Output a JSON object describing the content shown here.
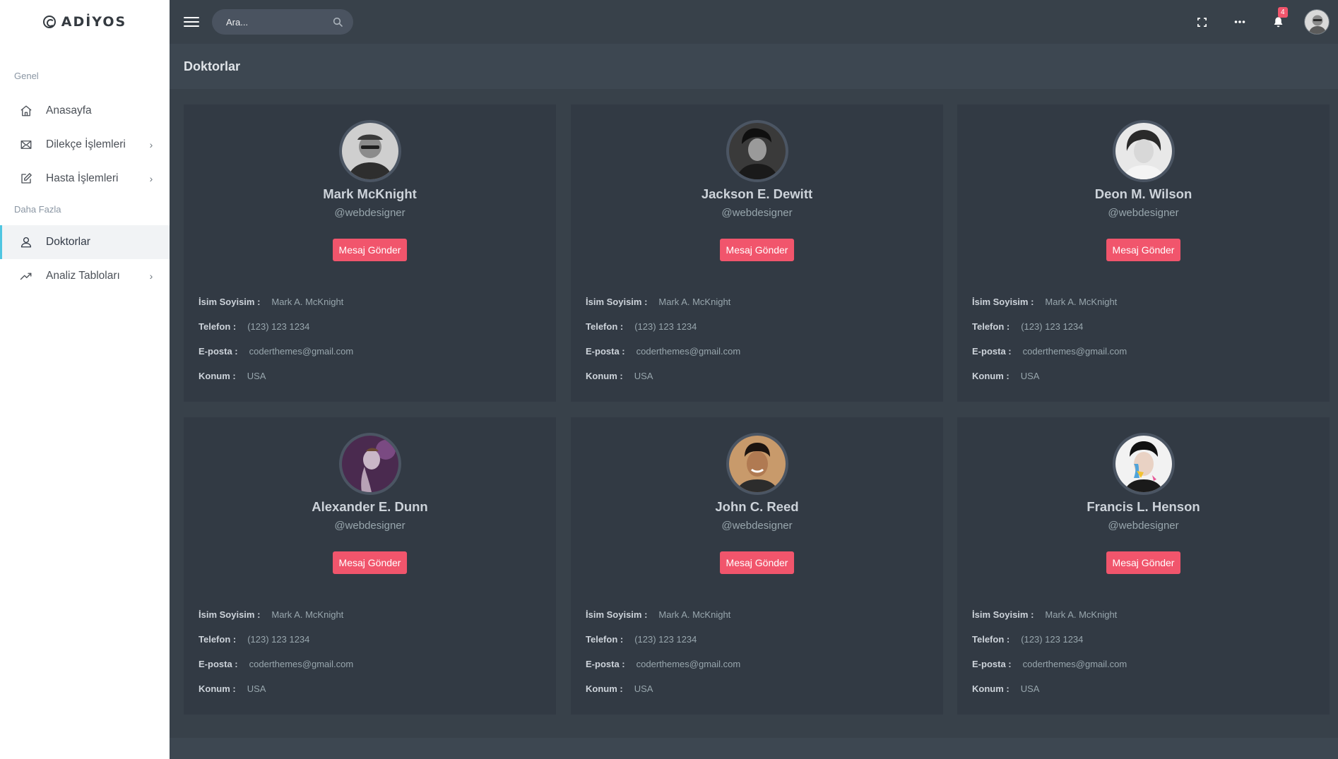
{
  "brand": {
    "name": "ADİYOS"
  },
  "sidebar": {
    "section_general": "Genel",
    "section_more": "Daha Fazla",
    "items": [
      {
        "label": "Anasayfa",
        "icon": "home-icon",
        "has_submenu": false
      },
      {
        "label": "Dilekçe İşlemleri",
        "icon": "envelope-icon",
        "has_submenu": true
      },
      {
        "label": "Hasta İşlemleri",
        "icon": "edit-icon",
        "has_submenu": true
      }
    ],
    "more_items": [
      {
        "label": "Doktorlar",
        "icon": "user-icon",
        "active": true,
        "has_submenu": false
      },
      {
        "label": "Analiz Tabloları",
        "icon": "trending-up-icon",
        "has_submenu": true
      }
    ]
  },
  "topbar": {
    "search_placeholder": "Ara...",
    "notification_count": "4",
    "icons": [
      "menu-icon",
      "search-icon",
      "fullscreen-icon",
      "more-icon",
      "bell-icon"
    ]
  },
  "page": {
    "title": "Doktorlar"
  },
  "labels": {
    "name": "İsim Soyisim :",
    "phone": "Telefon :",
    "email": "E-posta :",
    "location": "Konum :",
    "message_button": "Mesaj Gönder"
  },
  "doctors": [
    {
      "name": "Mark McKnight",
      "handle": "@webdesigner",
      "full_name": "Mark A. McKnight",
      "phone": "(123) 123 1234",
      "email": "coderthemes@gmail.com",
      "location": "USA"
    },
    {
      "name": "Jackson E. Dewitt",
      "handle": "@webdesigner",
      "full_name": "Mark A. McKnight",
      "phone": "(123) 123 1234",
      "email": "coderthemes@gmail.com",
      "location": "USA"
    },
    {
      "name": "Deon M. Wilson",
      "handle": "@webdesigner",
      "full_name": "Mark A. McKnight",
      "phone": "(123) 123 1234",
      "email": "coderthemes@gmail.com",
      "location": "USA"
    },
    {
      "name": "Alexander E. Dunn",
      "handle": "@webdesigner",
      "full_name": "Mark A. McKnight",
      "phone": "(123) 123 1234",
      "email": "coderthemes@gmail.com",
      "location": "USA"
    },
    {
      "name": "John C. Reed",
      "handle": "@webdesigner",
      "full_name": "Mark A. McKnight",
      "phone": "(123) 123 1234",
      "email": "coderthemes@gmail.com",
      "location": "USA"
    },
    {
      "name": "Francis L. Henson",
      "handle": "@webdesigner",
      "full_name": "Mark A. McKnight",
      "phone": "(123) 123 1234",
      "email": "coderthemes@gmail.com",
      "location": "USA"
    }
  ],
  "colors": {
    "accent": "#f1556c",
    "active_indicator": "#4fc6e1",
    "topbar_bg": "#38414a",
    "card_bg": "#323a44"
  }
}
